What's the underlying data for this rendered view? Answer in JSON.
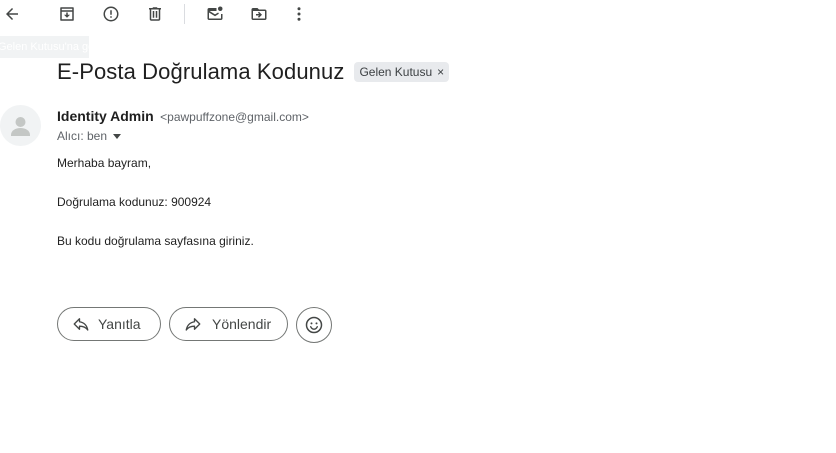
{
  "toolbar": {
    "icons": [
      "back-arrow-icon",
      "archive-icon",
      "report-spam-icon",
      "delete-icon",
      "mark-unread-icon",
      "move-to-icon",
      "more-vert-icon"
    ]
  },
  "tooltip": {
    "text": "Gelen Kutusu'na geri dön"
  },
  "email": {
    "subject": "E-Posta Doğrulama Kodunuz",
    "label": "Gelen Kutusu",
    "label_remove": "×",
    "sender_name": "Identity Admin",
    "sender_email": "<pawpuffzone@gmail.com>",
    "recipient": "Alıcı: ben",
    "body": {
      "greeting": "Merhaba bayram,",
      "code_line": "Doğrulama kodunuz: 900924",
      "instruction": "Bu kodu doğrulama sayfasına giriniz."
    }
  },
  "actions": {
    "reply_label": "Yanıtla",
    "forward_label": "Yönlendir"
  },
  "colors": {
    "text": "#1f1f1f",
    "secondary_text": "#5f6368",
    "chip_bg": "#e8eaed",
    "outline": "#747775"
  }
}
